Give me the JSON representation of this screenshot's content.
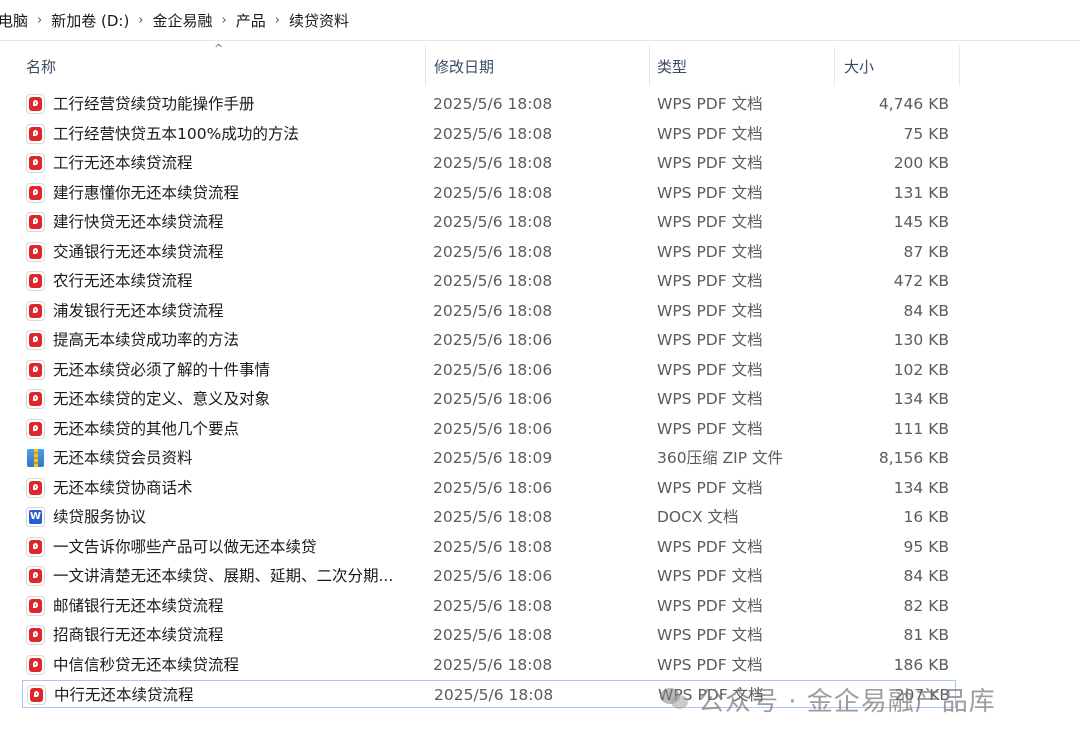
{
  "breadcrumb": [
    "电脑",
    "新加卷 (D:)",
    "金企易融",
    "产品",
    "续贷资料"
  ],
  "columns": {
    "name": "名称",
    "date": "修改日期",
    "type": "类型",
    "size": "大小"
  },
  "files": [
    {
      "name": "工行经营贷续贷功能操作手册",
      "date": "2025/5/6 18:08",
      "type": "WPS PDF 文档",
      "size": "4,746 KB",
      "icon": "pdf-icon"
    },
    {
      "name": "工行经营快贷五本100%成功的方法",
      "date": "2025/5/6 18:08",
      "type": "WPS PDF 文档",
      "size": "75 KB",
      "icon": "pdf-icon"
    },
    {
      "name": "工行无还本续贷流程",
      "date": "2025/5/6 18:08",
      "type": "WPS PDF 文档",
      "size": "200 KB",
      "icon": "pdf-icon"
    },
    {
      "name": "建行惠懂你无还本续贷流程",
      "date": "2025/5/6 18:08",
      "type": "WPS PDF 文档",
      "size": "131 KB",
      "icon": "pdf-icon"
    },
    {
      "name": "建行快贷无还本续贷流程",
      "date": "2025/5/6 18:08",
      "type": "WPS PDF 文档",
      "size": "145 KB",
      "icon": "pdf-icon"
    },
    {
      "name": "交通银行无还本续贷流程",
      "date": "2025/5/6 18:08",
      "type": "WPS PDF 文档",
      "size": "87 KB",
      "icon": "pdf-icon"
    },
    {
      "name": "农行无还本续贷流程",
      "date": "2025/5/6 18:08",
      "type": "WPS PDF 文档",
      "size": "472 KB",
      "icon": "pdf-icon"
    },
    {
      "name": "浦发银行无还本续贷流程",
      "date": "2025/5/6 18:08",
      "type": "WPS PDF 文档",
      "size": "84 KB",
      "icon": "pdf-icon"
    },
    {
      "name": "提高无本续贷成功率的方法",
      "date": "2025/5/6 18:06",
      "type": "WPS PDF 文档",
      "size": "130 KB",
      "icon": "pdf-icon"
    },
    {
      "name": "无还本续贷必须了解的十件事情",
      "date": "2025/5/6 18:06",
      "type": "WPS PDF 文档",
      "size": "102 KB",
      "icon": "pdf-icon"
    },
    {
      "name": "无还本续贷的定义、意义及对象",
      "date": "2025/5/6 18:06",
      "type": "WPS PDF 文档",
      "size": "134 KB",
      "icon": "pdf-icon"
    },
    {
      "name": "无还本续贷的其他几个要点",
      "date": "2025/5/6 18:06",
      "type": "WPS PDF 文档",
      "size": "111 KB",
      "icon": "pdf-icon"
    },
    {
      "name": "无还本续贷会员资料",
      "date": "2025/5/6 18:09",
      "type": "360压缩 ZIP 文件",
      "size": "8,156 KB",
      "icon": "zip-icon"
    },
    {
      "name": "无还本续贷协商话术",
      "date": "2025/5/6 18:06",
      "type": "WPS PDF 文档",
      "size": "134 KB",
      "icon": "pdf-icon"
    },
    {
      "name": "续贷服务协议",
      "date": "2025/5/6 18:08",
      "type": "DOCX 文档",
      "size": "16 KB",
      "icon": "docx-icon"
    },
    {
      "name": "一文告诉你哪些产品可以做无还本续贷",
      "date": "2025/5/6 18:08",
      "type": "WPS PDF 文档",
      "size": "95 KB",
      "icon": "pdf-icon"
    },
    {
      "name": "一文讲清楚无还本续贷、展期、延期、二次分期...",
      "date": "2025/5/6 18:06",
      "type": "WPS PDF 文档",
      "size": "84 KB",
      "icon": "pdf-icon"
    },
    {
      "name": "邮储银行无还本续贷流程",
      "date": "2025/5/6 18:08",
      "type": "WPS PDF 文档",
      "size": "82 KB",
      "icon": "pdf-icon"
    },
    {
      "name": "招商银行无还本续贷流程",
      "date": "2025/5/6 18:08",
      "type": "WPS PDF 文档",
      "size": "81 KB",
      "icon": "pdf-icon"
    },
    {
      "name": "中信信秒贷无还本续贷流程",
      "date": "2025/5/6 18:08",
      "type": "WPS PDF 文档",
      "size": "186 KB",
      "icon": "pdf-icon"
    },
    {
      "name": "中行无还本续贷流程",
      "date": "2025/5/6 18:08",
      "type": "WPS PDF 文档",
      "size": "207 KB",
      "icon": "pdf-icon"
    }
  ],
  "selected_index": 20,
  "watermark": "公众号 · 金企易融产品库"
}
